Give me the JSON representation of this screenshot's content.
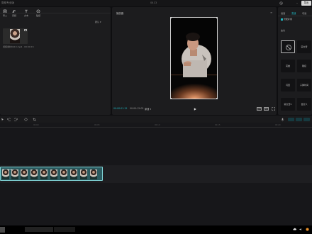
{
  "window": {
    "app_title": "剪映专业版",
    "project_title": "0413",
    "export_label": "导出",
    "minimize_label": "–"
  },
  "media": {
    "tools": [
      {
        "label": "导入",
        "icon": "import-icon"
      },
      {
        "label": "音频",
        "icon": "audio-icon"
      },
      {
        "label": "文本",
        "icon": "text-icon"
      },
      {
        "label": "贴纸",
        "icon": "sticker-icon"
      }
    ],
    "sort_label": "默认 ▾",
    "item_name": "视频素材0413.mp4 · 00:00:15"
  },
  "player": {
    "title": "播放器",
    "menu": "≡",
    "time_current": "00:00:01:15",
    "time_total": "00:00:15:05",
    "speed_label": "原速 ▾",
    "ratio_label": "比例",
    "fit_label": "适配"
  },
  "properties": {
    "tabs": [
      "画面",
      "变速",
      "动画"
    ],
    "active_tab": 1,
    "smart_check_label": "智能补帧",
    "section_label": "曲线",
    "tiles": [
      "无",
      "蒙太奇",
      "英雄",
      "跳接",
      "闪回",
      "子弹时间",
      "蒙太奇2",
      "自定义"
    ],
    "selected_tile": 0
  },
  "timeline": {
    "ticks": [
      "00:00",
      "00:05",
      "00:10",
      "00:15",
      "00:20"
    ],
    "clip_label": "视频素材0413.mp4"
  },
  "colors": {
    "accent": "#1fb9c4",
    "clip_fill": "#2b5b60",
    "clip_border": "#7fd3d6"
  }
}
